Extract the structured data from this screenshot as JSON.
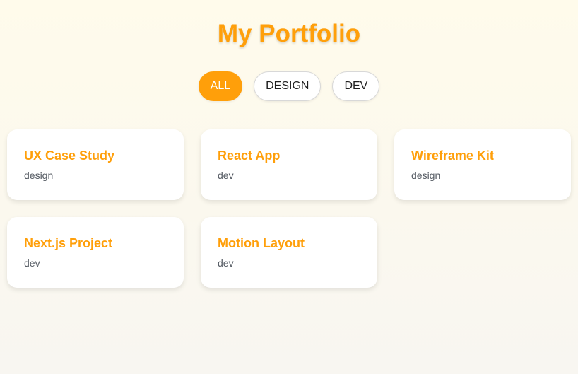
{
  "header": {
    "title": "My Portfolio"
  },
  "filters": {
    "items": [
      {
        "label": "ALL",
        "active": true
      },
      {
        "label": "DESIGN",
        "active": false
      },
      {
        "label": "DEV",
        "active": false
      }
    ]
  },
  "projects": [
    {
      "title": "UX Case Study",
      "tag": "design"
    },
    {
      "title": "React App",
      "tag": "dev"
    },
    {
      "title": "Wireframe Kit",
      "tag": "design"
    },
    {
      "title": "Next.js Project",
      "tag": "dev"
    },
    {
      "title": "Motion Layout",
      "tag": "dev"
    }
  ],
  "colors": {
    "accent": "#ff9f0a",
    "text": "#1f1f1f",
    "muted": "#555b63"
  }
}
